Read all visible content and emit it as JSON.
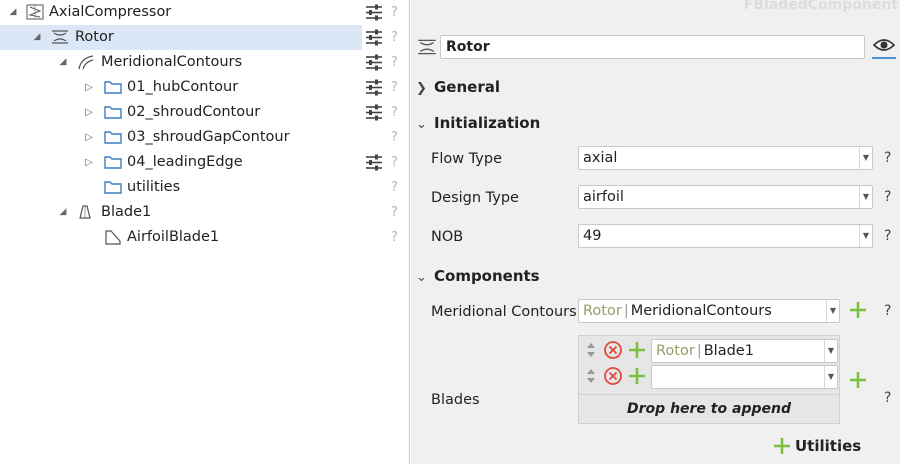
{
  "tree": {
    "items": [
      {
        "label": "AxialCompressor",
        "icon": "compressor-icon"
      },
      {
        "label": "Rotor",
        "icon": "rotor-icon"
      },
      {
        "label": "MeridionalContours",
        "icon": "contours-icon"
      },
      {
        "label": "01_hubContour",
        "icon": "folder-icon"
      },
      {
        "label": "02_shroudContour",
        "icon": "folder-icon"
      },
      {
        "label": "03_shroudGapContour",
        "icon": "folder-icon"
      },
      {
        "label": "04_leadingEdge",
        "icon": "folder-icon"
      },
      {
        "label": "utilities",
        "icon": "folder-icon"
      },
      {
        "label": "Blade1",
        "icon": "blade-icon"
      },
      {
        "label": "AirfoilBlade1",
        "icon": "airfoil-icon"
      }
    ],
    "help_glyph": "?"
  },
  "panel": {
    "watermark": "FBladedComponent",
    "name_value": "Rotor",
    "sections": {
      "general": "General",
      "initialization": "Initialization",
      "components": "Components"
    },
    "flow_type": {
      "label": "Flow Type",
      "value": "axial"
    },
    "design_type": {
      "label": "Design Type",
      "value": "airfoil"
    },
    "nob": {
      "label": "NOB",
      "value": "49"
    },
    "meridional_contours": {
      "label": "Meridional Contours",
      "prefix": "Rotor",
      "sep": "|",
      "value": "MeridionalContours"
    },
    "blades": {
      "label": "Blades",
      "entries": [
        {
          "prefix": "Rotor",
          "sep": "|",
          "value": "Blade1"
        },
        {
          "prefix": "",
          "sep": "",
          "value": ""
        }
      ],
      "drop_text": "Drop here to append"
    },
    "utilities_label": "Utilities",
    "help_glyph": "?"
  },
  "colors": {
    "selection": "#dbe7f6",
    "plus_green": "#7cc241",
    "remove_red": "#e04a3c",
    "accent_blue": "#4f8fd6",
    "folder_blue": "#3c7fc4"
  }
}
